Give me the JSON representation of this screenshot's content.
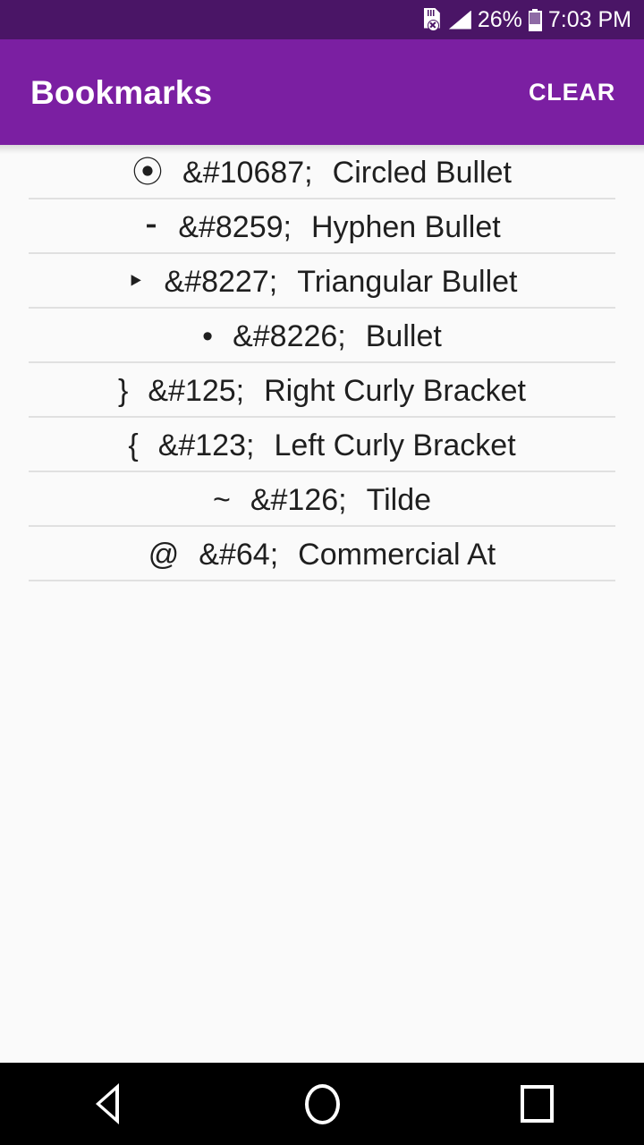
{
  "status_bar": {
    "sd_card_icon": "sd-card-off-icon",
    "signal_icon": "signal-cellular-icon",
    "battery_percent": "26%",
    "battery_icon": "battery-icon",
    "clock": "7:03 PM",
    "background_color": "#4A1566",
    "text_color": "#FFFFFF"
  },
  "app_bar": {
    "title": "Bookmarks",
    "clear_label": "CLEAR",
    "background_color": "#7B1FA2",
    "text_color": "#FFFFFF"
  },
  "list": {
    "background_color": "#FAFAFA",
    "text_color": "#1F1F1F",
    "divider_color": "#E0E0E0",
    "items": [
      {
        "glyph": "⦿",
        "entity": "&#10687;",
        "name": "Circled Bullet"
      },
      {
        "glyph": "⁃",
        "entity": "&#8259;",
        "name": "Hyphen Bullet"
      },
      {
        "glyph": "‣",
        "entity": "&#8227;",
        "name": "Triangular Bullet"
      },
      {
        "glyph": "•",
        "entity": "&#8226;",
        "name": "Bullet"
      },
      {
        "glyph": "}",
        "entity": "&#125;",
        "name": "Right Curly Bracket"
      },
      {
        "glyph": "{",
        "entity": "&#123;",
        "name": "Left Curly Bracket"
      },
      {
        "glyph": "~",
        "entity": "&#126;",
        "name": "Tilde"
      },
      {
        "glyph": "@",
        "entity": "&#64;",
        "name": "Commercial At"
      }
    ]
  },
  "nav_bar": {
    "background_color": "#000000",
    "back_label": "Back",
    "home_label": "Home",
    "recents_label": "Recents"
  }
}
